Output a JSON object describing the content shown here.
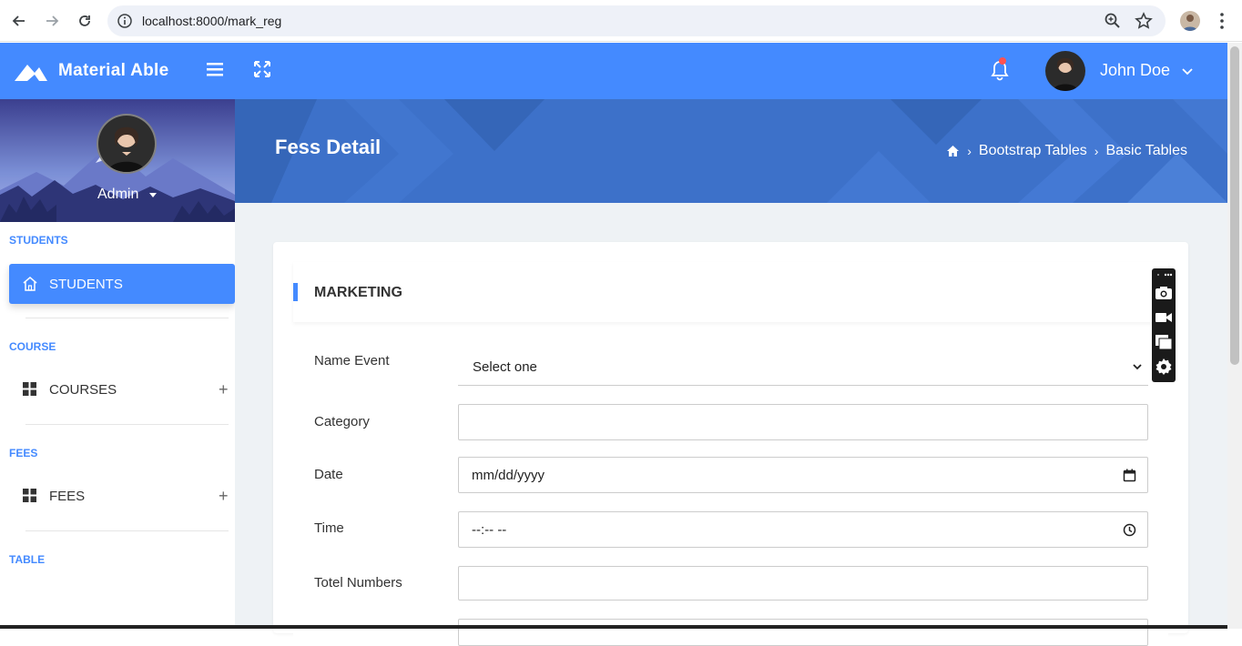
{
  "browser": {
    "url": "localhost:8000/mark_reg"
  },
  "header": {
    "brand": "Material Able",
    "user_name": "John Doe",
    "colors": {
      "primary": "#448aff",
      "notification": "#ff5252"
    }
  },
  "sidebar": {
    "admin_label": "Admin",
    "sections": [
      {
        "title": "STUDENTS"
      },
      {
        "title": "COURSE"
      },
      {
        "title": "FEES"
      },
      {
        "title": "TABLE"
      }
    ],
    "items": [
      {
        "label": "STUDENTS",
        "icon": "home-icon",
        "active": true
      },
      {
        "label": "COURSES",
        "icon": "grid-icon",
        "expand": "+"
      },
      {
        "label": "FEES",
        "icon": "grid-icon",
        "expand": "+"
      }
    ]
  },
  "page": {
    "title": "Fess Detail",
    "breadcrumb": [
      "Bootstrap Tables",
      "Basic Tables"
    ]
  },
  "form": {
    "card_title": "MARKETING",
    "fields": [
      {
        "label": "Name Event",
        "value": "Select one"
      },
      {
        "label": "Category",
        "value": ""
      },
      {
        "label": "Date",
        "value": "mm/dd/yyyy"
      },
      {
        "label": "Time",
        "value": "--:-- --"
      },
      {
        "label": "Totel Numbers",
        "value": ""
      }
    ]
  }
}
